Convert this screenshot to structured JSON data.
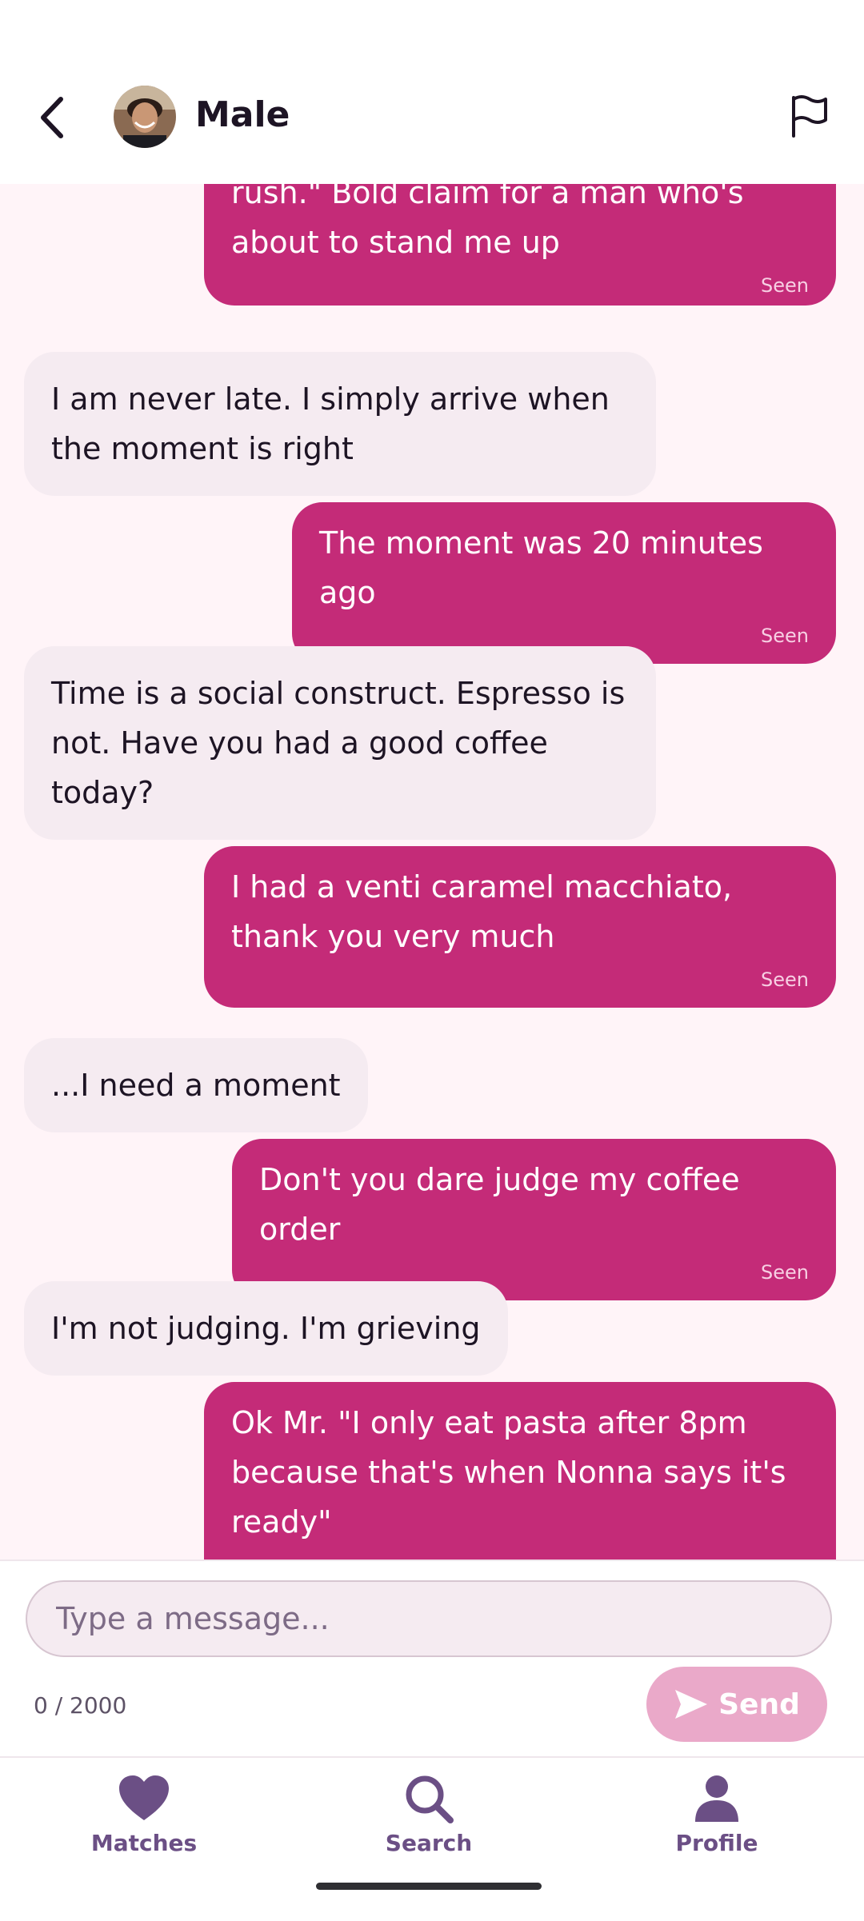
{
  "header": {
    "title": "Male"
  },
  "messages": [
    {
      "type": "outgoing",
      "text": "rush.\" Bold claim for a man who's about to stand me up",
      "status": "Seen"
    },
    {
      "type": "incoming",
      "text": "I am never late. I simply arrive when the moment is right"
    },
    {
      "type": "outgoing",
      "text": "The moment was 20 minutes ago",
      "status": "Seen"
    },
    {
      "type": "incoming",
      "text": "Time is a social construct. Espresso is not. Have you had a good coffee today?"
    },
    {
      "type": "outgoing",
      "text": "I had a venti caramel macchiato, thank you very much",
      "status": "Seen"
    },
    {
      "type": "incoming",
      "text": "...I need a moment"
    },
    {
      "type": "outgoing",
      "text": "Don't you dare judge my coffee order",
      "status": "Seen"
    },
    {
      "type": "incoming",
      "text": "I'm not judging. I'm grieving"
    },
    {
      "type": "outgoing",
      "text": "Ok Mr. \"I only eat pasta after 8pm because that's when Nonna says it's ready\""
    }
  ],
  "composer": {
    "placeholder": "Type a message...",
    "counter": "0 / 2000",
    "send_label": "Send"
  },
  "nav": {
    "items": [
      {
        "label": "Matches",
        "icon": "heart-icon"
      },
      {
        "label": "Search",
        "icon": "search-icon"
      },
      {
        "label": "Profile",
        "icon": "person-icon"
      }
    ]
  },
  "colors": {
    "outgoing_bubble": "#c42b78",
    "incoming_bubble": "#f5ebf1",
    "chat_background": "#fff4f8",
    "nav_accent": "#6b4f85",
    "send_disabled": "#eaa9c9"
  }
}
